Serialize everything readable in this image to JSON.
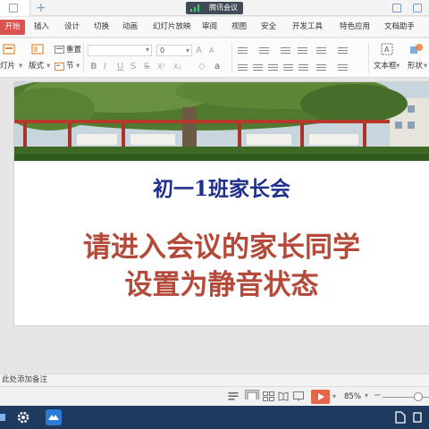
{
  "titlebar": {
    "meeting_label": "腾讯会议"
  },
  "menu": {
    "start": "开始",
    "items": [
      "插入",
      "设计",
      "切换",
      "动画",
      "幻灯片放映",
      "审阅",
      "视图",
      "安全",
      "开发工具",
      "特色应用",
      "文档助手"
    ]
  },
  "ribbon": {
    "new_slide_label": "灯片",
    "layout_label": "版式",
    "reset_label": "重置",
    "section_label": "节",
    "font_size_value": "0",
    "textbox_label": "文本框",
    "shape_label": "形状"
  },
  "slide": {
    "title": "初一1班家长会",
    "body_line1": "请进入会议的家长同学",
    "body_line2": "设置为静音状态"
  },
  "notes": {
    "placeholder": "此处添加备注"
  },
  "statusbar": {
    "zoom": "85%"
  },
  "colors": {
    "accent": "#d9534f",
    "slide_title": "#1f2f8c",
    "slide_body": "#b34a3a",
    "play_button": "#e4674a",
    "taskbar": "#1e3a5f"
  }
}
